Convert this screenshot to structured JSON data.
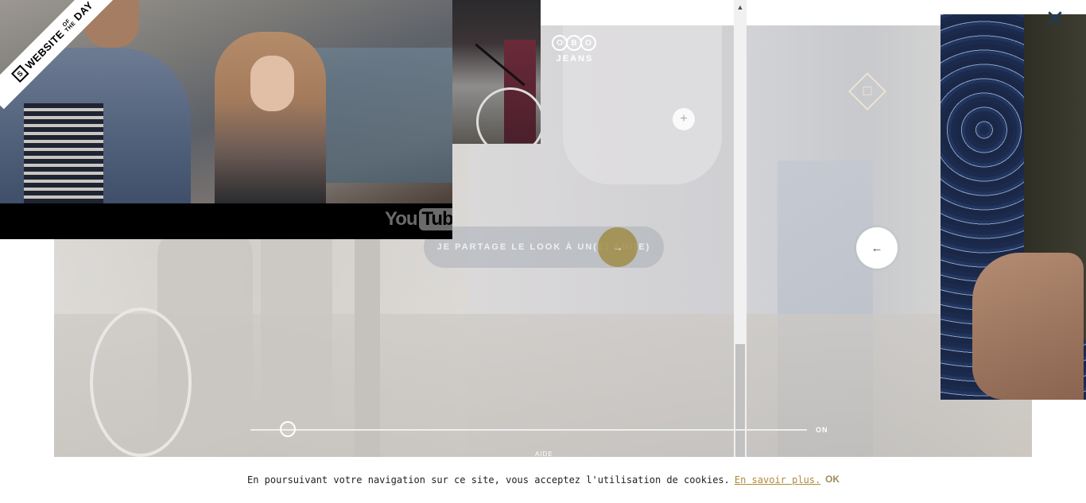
{
  "video": {
    "provider_logo_you": "You",
    "provider_logo_tube": "Tube"
  },
  "badge": {
    "line1": "WEBSITE",
    "line2_of": "OF",
    "line2_the": "THE",
    "line3": "DAY"
  },
  "logo": {
    "letters": [
      "O",
      "B",
      "O"
    ],
    "subtitle": "JEANS"
  },
  "controls": {
    "plus": "+",
    "share_label": "JE PARTAGE LE LOOK À UN(E) AMI(E)",
    "next_arrow": "→",
    "back_arrow": "←",
    "slider_label": "ON",
    "help_label": "AIDE",
    "close": "✕",
    "scroll_up": "▲"
  },
  "cookie": {
    "message": "En poursuivant votre navigation sur ce site, vous acceptez l'utilisation de cookies.",
    "link": "En savoir plus.",
    "ok": "OK"
  },
  "colors": {
    "accent_gold": "#b08a3a",
    "close_icon": "#1f3b57",
    "gold_button": "#a08c46"
  }
}
